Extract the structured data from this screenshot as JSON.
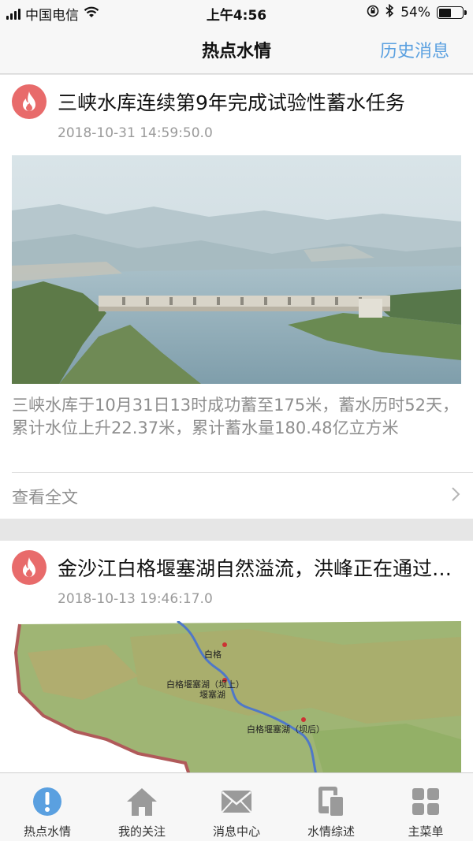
{
  "status_bar": {
    "carrier": "中国电信",
    "time": "上午4:56",
    "battery": "54%",
    "battery_level": 0.54
  },
  "nav": {
    "title": "热点水情",
    "right_link": "历史消息"
  },
  "cards": [
    {
      "title": "三峡水库连续第9年完成试验性蓄水任务",
      "timestamp": "2018-10-31 14:59:50.0",
      "image": "three-gorges-dam-photo",
      "summary": "三峡水库于10月31日13时成功蓄至175米，蓄水历时52天，累计水位上升22.37米，累计蓄水量180.48亿立方米",
      "read_more": "查看全文"
    },
    {
      "title": "金沙江白格堰塞湖自然溢流，洪峰正在通过…",
      "timestamp": "2018-10-13 19:46:17.0",
      "image": "baige-landslide-lake-relief-map",
      "map_labels": [
        "白格",
        "白格堰塞湖（坝上）",
        "堰塞湖",
        "白格堰塞湖（坝后）"
      ]
    }
  ],
  "tabs": [
    {
      "label": "热点水情",
      "icon": "alert-icon",
      "active": true
    },
    {
      "label": "我的关注",
      "icon": "home-icon",
      "active": false
    },
    {
      "label": "消息中心",
      "icon": "mail-icon",
      "active": false
    },
    {
      "label": "水情综述",
      "icon": "document-icon",
      "active": false
    },
    {
      "label": "主菜单",
      "icon": "grid-icon",
      "active": false
    }
  ],
  "colors": {
    "accent": "#5aa0e0",
    "badge": "#e86b6b",
    "active_tab": "#5aa0e0",
    "inactive_tab": "#9a9a9a"
  }
}
